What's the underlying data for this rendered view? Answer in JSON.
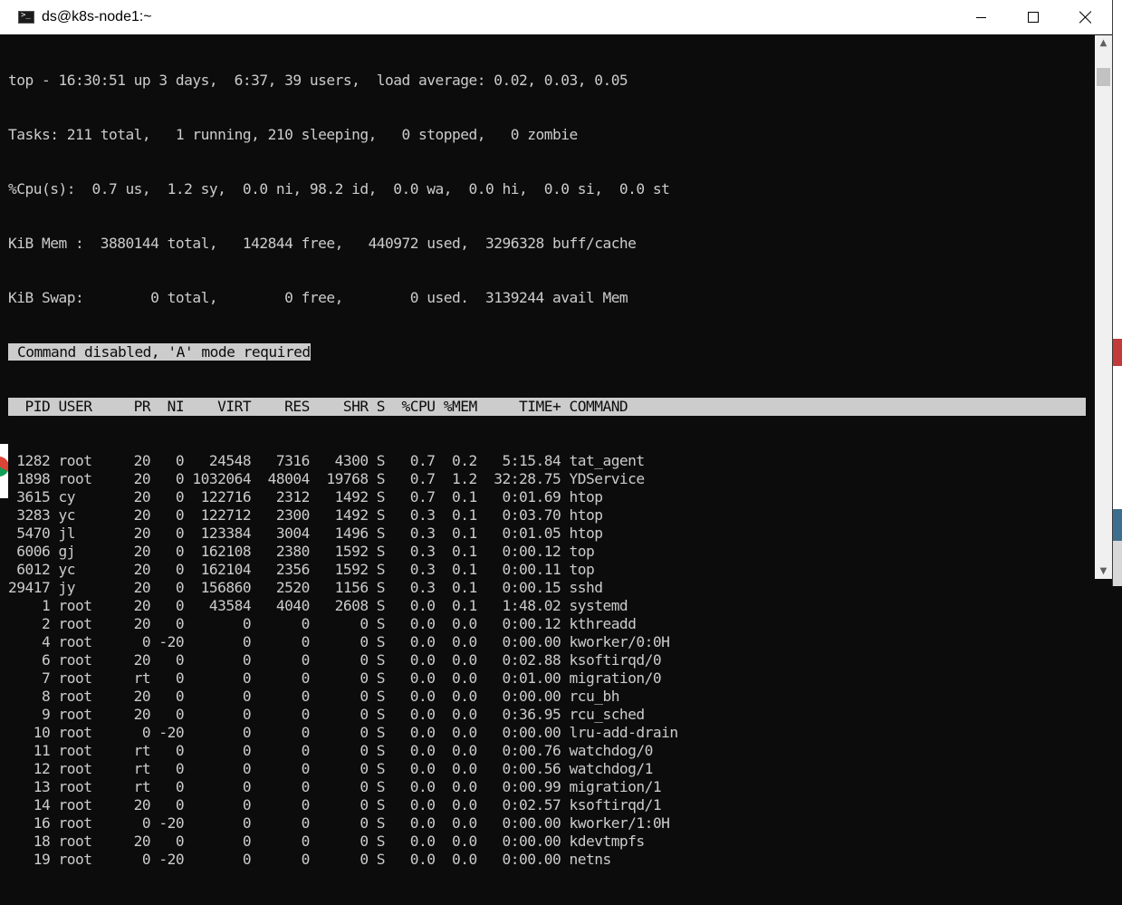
{
  "window": {
    "title": "ds@k8s-node1:~",
    "icon": "terminal-icon"
  },
  "summary": {
    "line1": "top - 16:30:51 up 3 days,  6:37, 39 users,  load average: 0.02, 0.03, 0.05",
    "line2": "Tasks: 211 total,   1 running, 210 sleeping,   0 stopped,   0 zombie",
    "line3": "%Cpu(s):  0.7 us,  1.2 sy,  0.0 ni, 98.2 id,  0.0 wa,  0.0 hi,  0.0 si,  0.0 st",
    "line4": "KiB Mem :  3880144 total,   142844 free,   440972 used,  3296328 buff/cache",
    "line5": "KiB Swap:        0 total,        0 free,        0 used.  3139244 avail Mem"
  },
  "message": "Command disabled, 'A' mode required",
  "columns": [
    "PID",
    "USER",
    "PR",
    "NI",
    "VIRT",
    "RES",
    "SHR",
    "S",
    "%CPU",
    "%MEM",
    "TIME+",
    "COMMAND"
  ],
  "processes": [
    [
      "1282",
      "root",
      "20",
      "0",
      "24548",
      "7316",
      "4300",
      "S",
      "0.7",
      "0.2",
      "5:15.84",
      "tat_agent"
    ],
    [
      "1898",
      "root",
      "20",
      "0",
      "1032064",
      "48004",
      "19768",
      "S",
      "0.7",
      "1.2",
      "32:28.75",
      "YDService"
    ],
    [
      "3615",
      "cy",
      "20",
      "0",
      "122716",
      "2312",
      "1492",
      "S",
      "0.7",
      "0.1",
      "0:01.69",
      "htop"
    ],
    [
      "3283",
      "yc",
      "20",
      "0",
      "122712",
      "2300",
      "1492",
      "S",
      "0.3",
      "0.1",
      "0:03.70",
      "htop"
    ],
    [
      "5470",
      "jl",
      "20",
      "0",
      "123384",
      "3004",
      "1496",
      "S",
      "0.3",
      "0.1",
      "0:01.05",
      "htop"
    ],
    [
      "6006",
      "gj",
      "20",
      "0",
      "162108",
      "2380",
      "1592",
      "S",
      "0.3",
      "0.1",
      "0:00.12",
      "top"
    ],
    [
      "6012",
      "yc",
      "20",
      "0",
      "162104",
      "2356",
      "1592",
      "S",
      "0.3",
      "0.1",
      "0:00.11",
      "top"
    ],
    [
      "29417",
      "jy",
      "20",
      "0",
      "156860",
      "2520",
      "1156",
      "S",
      "0.3",
      "0.1",
      "0:00.15",
      "sshd"
    ],
    [
      "1",
      "root",
      "20",
      "0",
      "43584",
      "4040",
      "2608",
      "S",
      "0.0",
      "0.1",
      "1:48.02",
      "systemd"
    ],
    [
      "2",
      "root",
      "20",
      "0",
      "0",
      "0",
      "0",
      "S",
      "0.0",
      "0.0",
      "0:00.12",
      "kthreadd"
    ],
    [
      "4",
      "root",
      "0",
      "-20",
      "0",
      "0",
      "0",
      "S",
      "0.0",
      "0.0",
      "0:00.00",
      "kworker/0:0H"
    ],
    [
      "6",
      "root",
      "20",
      "0",
      "0",
      "0",
      "0",
      "S",
      "0.0",
      "0.0",
      "0:02.88",
      "ksoftirqd/0"
    ],
    [
      "7",
      "root",
      "rt",
      "0",
      "0",
      "0",
      "0",
      "S",
      "0.0",
      "0.0",
      "0:01.00",
      "migration/0"
    ],
    [
      "8",
      "root",
      "20",
      "0",
      "0",
      "0",
      "0",
      "S",
      "0.0",
      "0.0",
      "0:00.00",
      "rcu_bh"
    ],
    [
      "9",
      "root",
      "20",
      "0",
      "0",
      "0",
      "0",
      "S",
      "0.0",
      "0.0",
      "0:36.95",
      "rcu_sched"
    ],
    [
      "10",
      "root",
      "0",
      "-20",
      "0",
      "0",
      "0",
      "S",
      "0.0",
      "0.0",
      "0:00.00",
      "lru-add-drain"
    ],
    [
      "11",
      "root",
      "rt",
      "0",
      "0",
      "0",
      "0",
      "S",
      "0.0",
      "0.0",
      "0:00.76",
      "watchdog/0"
    ],
    [
      "12",
      "root",
      "rt",
      "0",
      "0",
      "0",
      "0",
      "S",
      "0.0",
      "0.0",
      "0:00.56",
      "watchdog/1"
    ],
    [
      "13",
      "root",
      "rt",
      "0",
      "0",
      "0",
      "0",
      "S",
      "0.0",
      "0.0",
      "0:00.99",
      "migration/1"
    ],
    [
      "14",
      "root",
      "20",
      "0",
      "0",
      "0",
      "0",
      "S",
      "0.0",
      "0.0",
      "0:02.57",
      "ksoftirqd/1"
    ],
    [
      "16",
      "root",
      "0",
      "-20",
      "0",
      "0",
      "0",
      "S",
      "0.0",
      "0.0",
      "0:00.00",
      "kworker/1:0H"
    ],
    [
      "18",
      "root",
      "20",
      "0",
      "0",
      "0",
      "0",
      "S",
      "0.0",
      "0.0",
      "0:00.00",
      "kdevtmpfs"
    ],
    [
      "19",
      "root",
      "0",
      "-20",
      "0",
      "0",
      "0",
      "S",
      "0.0",
      "0.0",
      "0:00.00",
      "netns"
    ]
  ],
  "colors": {
    "background": "#0c0c0c",
    "text": "#cccccc",
    "highlight": "#cccccc"
  }
}
